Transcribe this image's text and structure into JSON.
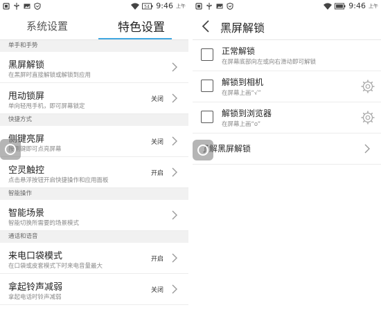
{
  "status": {
    "time": "9:46",
    "time_suffix": "上午",
    "battery": "54"
  },
  "left": {
    "tabs": [
      "系统设置",
      "特色设置"
    ],
    "sections": [
      {
        "header": "单手和手势",
        "items": [
          {
            "title": "黑屏解锁",
            "sub": "在黑屏时直接解锁或解锁到应用",
            "value": ""
          },
          {
            "title": "甩动锁屏",
            "sub": "单向轻甩手机，即可屏幕锁定",
            "value": "关闭"
          }
        ]
      },
      {
        "header": "快捷方式",
        "items": [
          {
            "title": "侧键亮屏",
            "sub": "按侧键即可点亮屏幕",
            "value": "关闭"
          },
          {
            "title": "空灵触控",
            "sub": "点击悬浮按钮开启快捷操作和应用面板",
            "value": "开启"
          }
        ]
      },
      {
        "header": "智能操作",
        "items": [
          {
            "title": "智能场景",
            "sub": "智能切换所需要的场景模式",
            "value": ""
          }
        ]
      },
      {
        "header": "通话和语音",
        "items": [
          {
            "title": "来电口袋模式",
            "sub": "在口袋或皮套模式下时来电音量最大",
            "value": "开启"
          },
          {
            "title": "拿起铃声减弱",
            "sub": "拿起电话时铃声减弱",
            "value": "关闭"
          }
        ]
      }
    ]
  },
  "right": {
    "title": "黑屏解锁",
    "options": [
      {
        "title": "正常解锁",
        "sub": "在屏幕底部向左或向右滑动即可解锁"
      },
      {
        "title": "解锁到相机",
        "sub": "在屏幕上画“√”"
      },
      {
        "title": "解锁到浏览器",
        "sub": "在屏幕上画“o”"
      }
    ],
    "learn_more": "了解黑屏解锁"
  },
  "colors": {
    "accent": "#3fa6e0",
    "section_bg": "#f1f1f1"
  }
}
